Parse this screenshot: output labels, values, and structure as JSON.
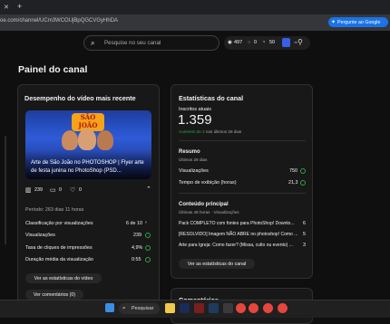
{
  "browser": {
    "url": "oe.com/channel/UCm3WCOUjBpQGCVGyHhDA",
    "gemini_label": "Pergunte ao Google",
    "new_tab": "+"
  },
  "header": {
    "search_placeholder": "Pesquise no seu canal",
    "stats": {
      "views": "497",
      "comments": "0",
      "subs": "50"
    }
  },
  "page": {
    "title": "Painel do canal"
  },
  "video_card": {
    "title": "Desempenho do vídeo mais recente",
    "thumb_logo": "SÃO JOÃO",
    "video_title": "Arte de São João no PHOTOSHOP | Flyer arte de festa junina no PhotoShop (PSD...",
    "metrics": {
      "views": "239",
      "comments": "0",
      "likes": "0"
    },
    "period": "Período: 263 dias 11 horas",
    "rows": [
      {
        "label": "Classificação por visualizações",
        "value": "6 de 10"
      },
      {
        "label": "Visualizações",
        "value": "239"
      },
      {
        "label": "Taxa de cliques de impressões",
        "value": "4,9%"
      },
      {
        "label": "Duração média da visualização",
        "value": "0:55"
      }
    ],
    "btn_stats": "Ver as estatísticas do vídeo",
    "btn_comments": "Ver comentários (0)"
  },
  "stats_card": {
    "title": "Estatísticas do canal",
    "subs_label": "Inscritos atuais",
    "subs_value": "1.359",
    "subs_delta_prefix": "Aumento de 3",
    "subs_delta_suffix": " nos últimos 28 dias",
    "summary_title": "Resumo",
    "summary_sub": "Últimos 28 dias",
    "summary_rows": [
      {
        "label": "Visualizações",
        "value": "750"
      },
      {
        "label": "Tempo de exibição (horas)",
        "value": "21,3"
      }
    ],
    "top_title": "Conteúdo principal",
    "top_sub": "Últimas 48 horas · Visualizações",
    "top_rows": [
      {
        "label": "Pack COMPLETO com fontes para PhotoShop! Downlo...",
        "value": "6"
      },
      {
        "label": "[RESOLVIDO] Imagem NÃO ABRE no photoshop! Como ...",
        "value": "5"
      },
      {
        "label": "Arte para Igreja: Como fazer? (Missa, culto ou evento) ...",
        "value": "3"
      }
    ],
    "btn_analytics": "Ver as estatísticas do canal"
  },
  "comments_card": {
    "title": "Comentários"
  },
  "taskbar": {
    "search_label": "Pesquisar"
  },
  "colors": {
    "accent_blue": "#1a73e8",
    "positive_green": "#2ba640",
    "background": "#0f0f0f",
    "card": "#181818"
  }
}
